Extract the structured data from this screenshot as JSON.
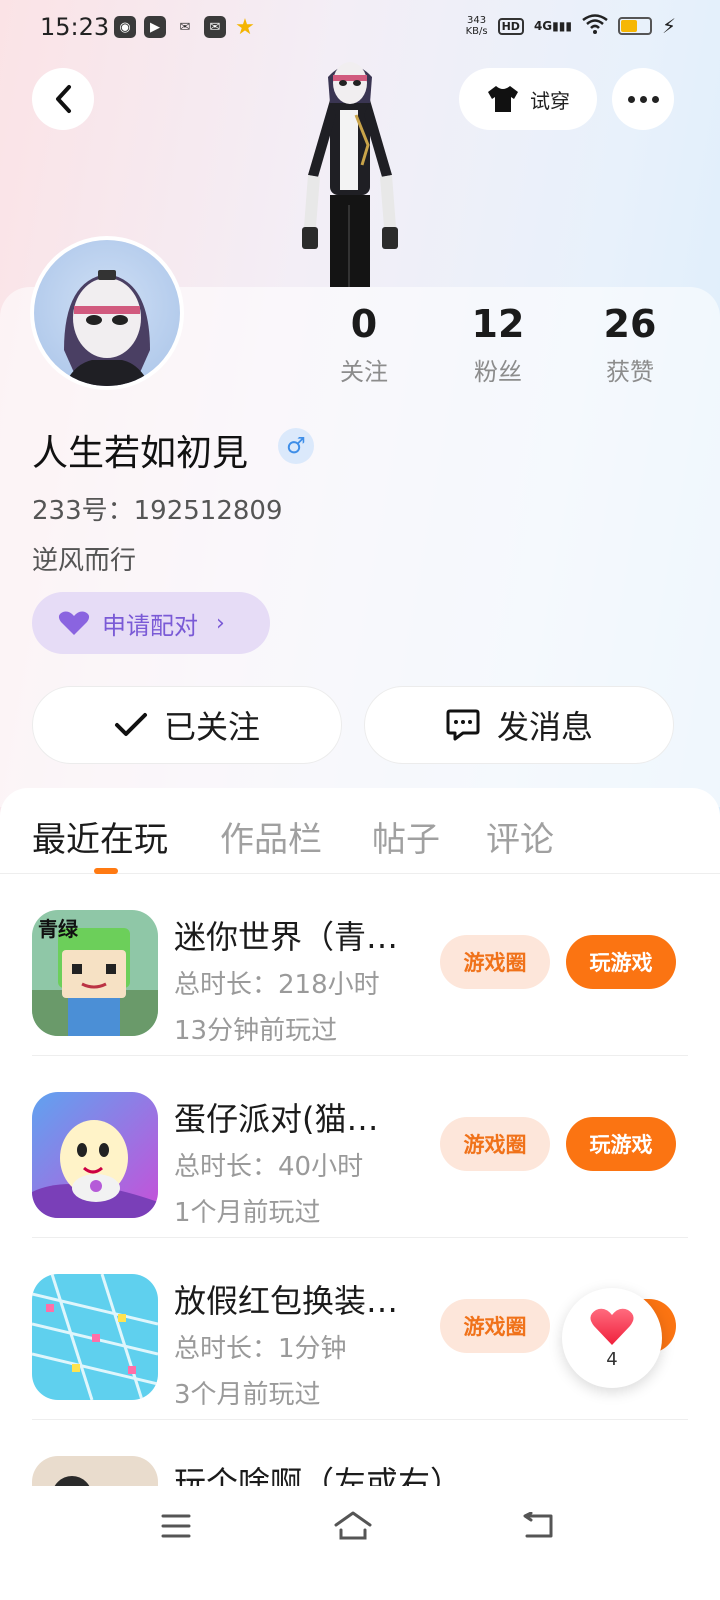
{
  "status_bar": {
    "time": "15:23",
    "speed_top": "343",
    "speed_unit": "KB/s",
    "hd": "HD",
    "network": "4G"
  },
  "header": {
    "try_on_label": "试穿"
  },
  "profile": {
    "stats": [
      {
        "value": "0",
        "label": "关注"
      },
      {
        "value": "12",
        "label": "粉丝"
      },
      {
        "value": "26",
        "label": "获赞"
      }
    ],
    "username": "人生若如初見",
    "gender_symbol": "♂",
    "user_id": "233号：192512809",
    "bio": "逆风而行",
    "pair_label": "申请配对",
    "follow_label": "已关注",
    "message_label": "发消息"
  },
  "tabs": [
    {
      "label": "最近在玩",
      "active": true
    },
    {
      "label": "作品栏",
      "active": false
    },
    {
      "label": "帖子",
      "active": false
    },
    {
      "label": "评论",
      "active": false
    }
  ],
  "games": [
    {
      "title": "迷你世界（青…",
      "duration": "总时长：218小时",
      "last_played": "13分钟前玩过",
      "circle_label": "游戏圈",
      "play_label": "玩游戏"
    },
    {
      "title": "蛋仔派对(猫…",
      "duration": "总时长：40小时",
      "last_played": "1个月前玩过",
      "circle_label": "游戏圈",
      "play_label": "玩游戏"
    },
    {
      "title": "放假红包换装…",
      "duration": "总时长：1分钟",
      "last_played": "3个月前玩过",
      "circle_label": "游戏圈",
      "play_label": "玩游戏"
    },
    {
      "title": "玩个啥啊（左或右）",
      "duration": "",
      "last_played": "",
      "circle_label": "",
      "play_label": ""
    }
  ],
  "like_float": {
    "count": "4"
  },
  "colors": {
    "accent": "#fb7412",
    "accent_soft": "#fde6da",
    "pair_bg": "#e6dcf6",
    "pair_text": "#7a5ad6",
    "gender": "#3e8ee8"
  }
}
